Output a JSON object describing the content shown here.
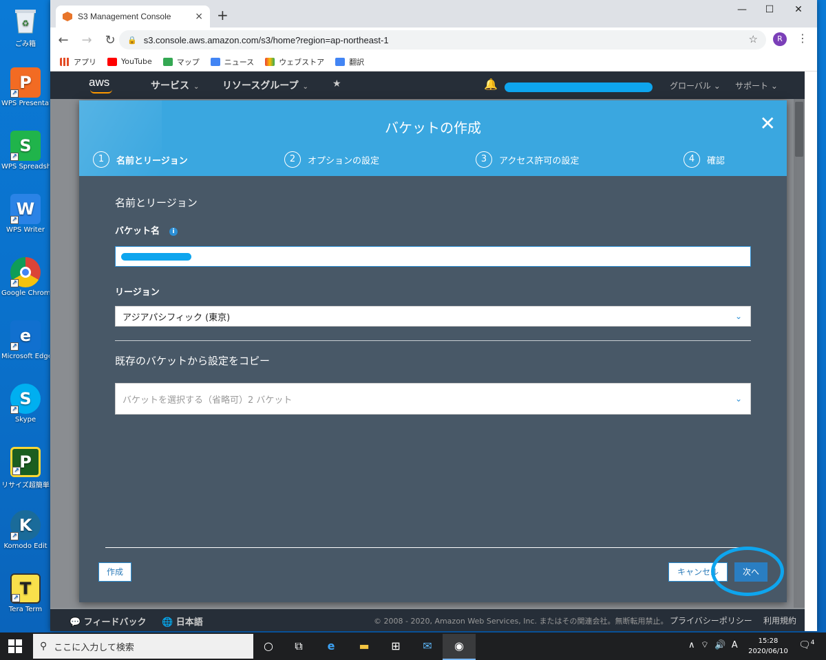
{
  "desktop": {
    "icons": [
      {
        "label": "ごみ箱"
      },
      {
        "label": "WPS Presentat"
      },
      {
        "label": "WPS Spreadsh"
      },
      {
        "label": "WPS Writer"
      },
      {
        "label": "Google Chrome"
      },
      {
        "label": "Microsoft Edge"
      },
      {
        "label": "Skype"
      },
      {
        "label": "リサイズ超簡単"
      },
      {
        "label": "Komodo Edit"
      },
      {
        "label": "Tera Term"
      }
    ]
  },
  "browser": {
    "tab_title": "S3 Management Console",
    "tab_close": "×",
    "new_tab": "+",
    "url": "s3.console.aws.amazon.com/s3/home?region=ap-northeast-1",
    "avatar_letter": "R",
    "bookmarks": [
      {
        "label": "アプリ",
        "color": "#e34c26"
      },
      {
        "label": "YouTube",
        "color": "#ff0000"
      },
      {
        "label": "マップ",
        "color": "#34a853"
      },
      {
        "label": "ニュース",
        "color": "#4285f4"
      },
      {
        "label": "ウェブストア",
        "color": "#fbbc05"
      },
      {
        "label": "翻訳",
        "color": "#4285f4"
      }
    ]
  },
  "aws": {
    "logo": "aws",
    "nav": {
      "services": "サービス",
      "resource_groups": "リソースグループ",
      "region": "グローバル",
      "support": "サポート"
    },
    "footer": {
      "feedback": "フィードバック",
      "language": "日本語",
      "copyright": "© 2008 - 2020, Amazon Web Services, Inc. またはその関連会社。無断転用禁止。",
      "privacy": "プライバシーポリシー",
      "terms": "利用規約"
    }
  },
  "modal": {
    "title": "バケットの作成",
    "steps": [
      {
        "num": "1",
        "label": "名前とリージョン",
        "active": true
      },
      {
        "num": "2",
        "label": "オプションの設定",
        "active": false
      },
      {
        "num": "3",
        "label": "アクセス許可の設定",
        "active": false
      },
      {
        "num": "4",
        "label": "確認",
        "active": false
      }
    ],
    "section_title": "名前とリージョン",
    "bucket_name_label": "バケット名",
    "region_label": "リージョン",
    "region_value": "アジアパシフィック (東京)",
    "copy_section_title": "既存のバケットから設定をコピー",
    "copy_placeholder": "バケットを選択する（省略可）2 バケット",
    "create_button": "作成",
    "cancel_button": "キャンセル",
    "next_button": "次へ",
    "accent": "#3aa7e0"
  },
  "taskbar": {
    "search_placeholder": "ここに入力して検索",
    "time": "15:28",
    "date": "2020/06/10",
    "ime": "A",
    "notifications": "4"
  }
}
